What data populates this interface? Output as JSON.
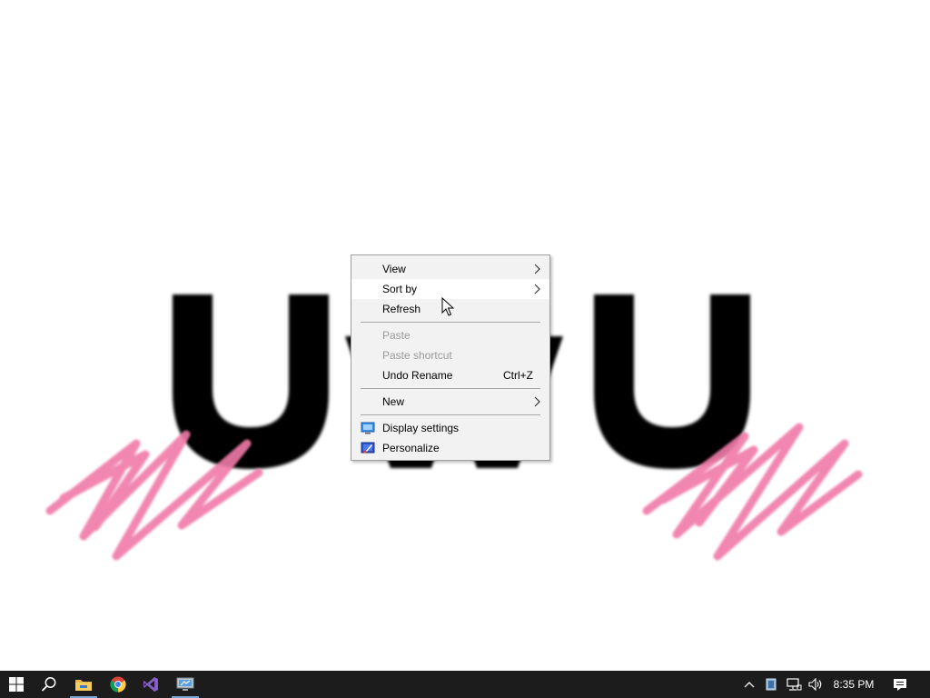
{
  "wallpaper": {
    "text": "U w U",
    "scribble_color": "#f07aa8"
  },
  "context_menu": {
    "items": [
      {
        "label": "View",
        "submenu": true
      },
      {
        "label": "Sort by",
        "submenu": true,
        "highlighted": true
      },
      {
        "label": "Refresh"
      },
      {
        "label": "Paste",
        "disabled": true
      },
      {
        "label": "Paste shortcut",
        "disabled": true
      },
      {
        "label": "Undo Rename",
        "shortcut": "Ctrl+Z"
      },
      {
        "label": "New",
        "submenu": true
      },
      {
        "label": "Display settings",
        "icon": "display-settings-icon"
      },
      {
        "label": "Personalize",
        "icon": "personalize-icon"
      }
    ]
  },
  "taskbar": {
    "pinned": [
      {
        "name": "start-button",
        "icon": "windows-logo-icon"
      },
      {
        "name": "search-button",
        "icon": "search-icon"
      },
      {
        "name": "file-explorer",
        "icon": "folder-icon",
        "active": true
      },
      {
        "name": "chrome",
        "icon": "chrome-icon"
      },
      {
        "name": "visual-studio",
        "icon": "visual-studio-icon"
      },
      {
        "name": "remote-desktop",
        "icon": "remote-desktop-icon",
        "active": true
      }
    ],
    "tray": {
      "icons": [
        "chevron-up-icon",
        "tablet-icon",
        "network-icon",
        "volume-icon"
      ],
      "clock": "8:35 PM",
      "notifications_icon": "action-center-icon"
    }
  },
  "colors": {
    "taskbar_bg": "#1c1c1c",
    "menu_bg": "#f2f2f2",
    "accent": "#7aa7d8"
  }
}
